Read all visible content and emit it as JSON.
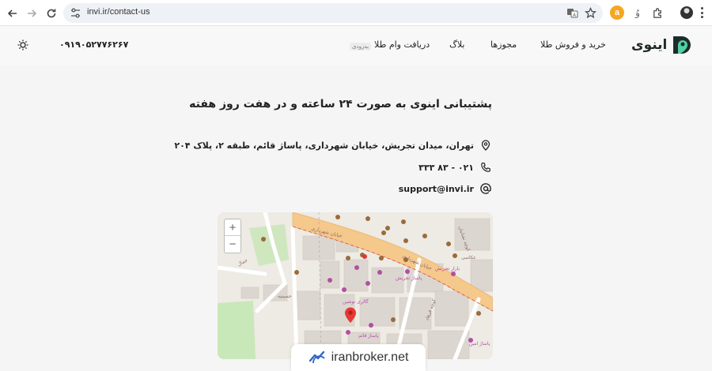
{
  "browser": {
    "url": "invi.ir/contact-us",
    "ext_a_label": "a",
    "ext_fa_label": "وُ"
  },
  "header": {
    "logo_text": "اینوی",
    "nav": {
      "buy_sell": "خرید و فروش طلا",
      "licenses": "مجوزها",
      "blog": "بلاگ",
      "gold_loan": "دریافت وام طلا",
      "gold_loan_badge": "به‌زودی"
    },
    "phone": "۰۹۱۹۰۵۲۷۷۶۲۶۷"
  },
  "content": {
    "title": "پشتیبانی اینوی به صورت ۲۴ ساعته و در هفت روز هفته",
    "address": "تهران، میدان تجریش، خیابان شهرداری، پاساژ قائم، طبقه ۲، پلاک ۲۰۴",
    "phone": "۰۲۱ - ۸۳ ۳۳۳",
    "email": "support@invi.ir"
  },
  "map": {
    "zoom_in": "+",
    "zoom_out": "−",
    "labels": {
      "street_main": "خیابان شهرداری",
      "street_main2": "خیابان شهرداری",
      "street_small": "کوچه نشانیان",
      "street_side": "کوچه فرهاد",
      "gallery": "گالری نوشین",
      "passage": "پاساژ قائم",
      "passage2": "پاساژ تجریش",
      "shop": "عکاسی",
      "bazar": "بازار تجریش",
      "amin": "پاساژ امین",
      "hoseinieh": "حسینیه",
      "jamal": "جمال"
    },
    "colors": {
      "road": "#f5c88b",
      "park": "#c9e8b9",
      "building": "#dcd6d0",
      "pin": "#e53935"
    }
  },
  "watermark": {
    "text": "iranbroker.net"
  },
  "colors": {
    "accent": "#1a9c85",
    "text": "#222222"
  }
}
